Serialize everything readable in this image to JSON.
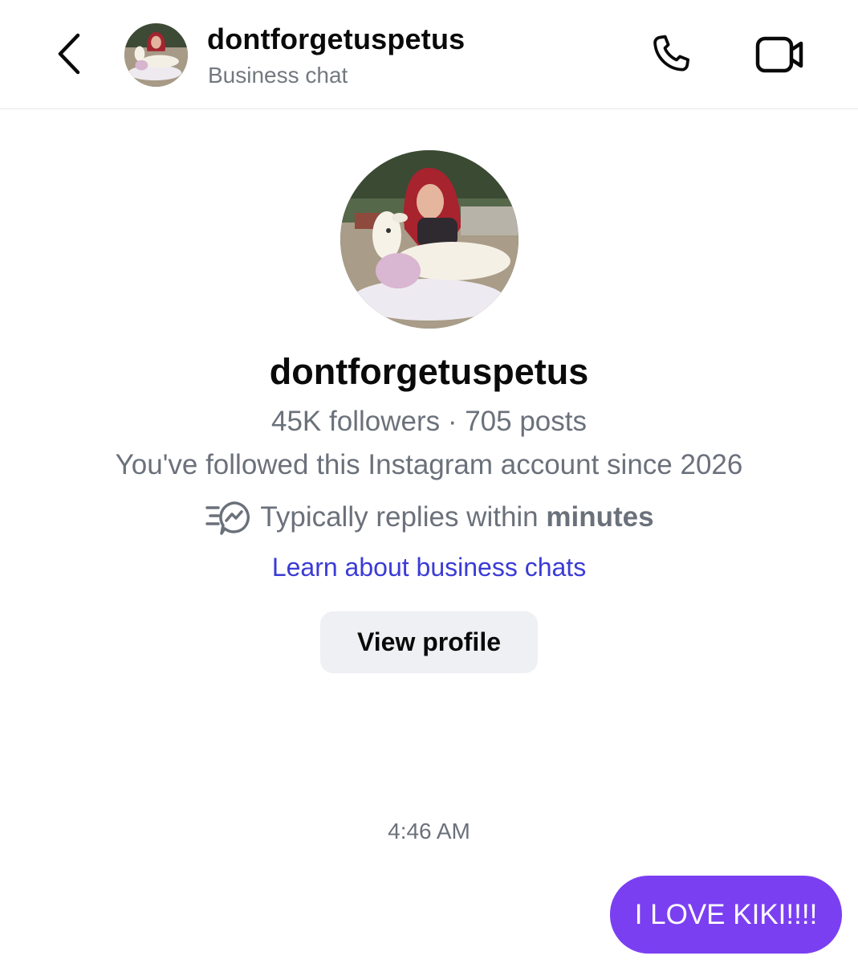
{
  "header": {
    "back_icon": "chevron-left-icon",
    "username": "dontforgetuspetus",
    "subtitle": "Business chat",
    "call_icon": "phone-icon",
    "video_icon": "video-camera-icon"
  },
  "profile": {
    "username": "dontforgetuspetus",
    "followers": "45K followers",
    "separator": " · ",
    "posts": "705 posts",
    "followed_since": "You've followed this Instagram account since 2026",
    "replies_prefix": "Typically replies within ",
    "replies_emphasis": "minutes",
    "replies_icon": "fast-reply-icon",
    "learn_link": "Learn about business chats",
    "view_profile_label": "View profile"
  },
  "conversation": {
    "timestamp": "4:46 AM",
    "messages": [
      {
        "from": "me",
        "text": "I LOVE KIKI!!!!"
      }
    ]
  },
  "colors": {
    "accent_link": "#3b3bd6",
    "bubble": "#7b3ff2",
    "muted_text": "#6b717b",
    "button_bg": "#eff0f4"
  }
}
